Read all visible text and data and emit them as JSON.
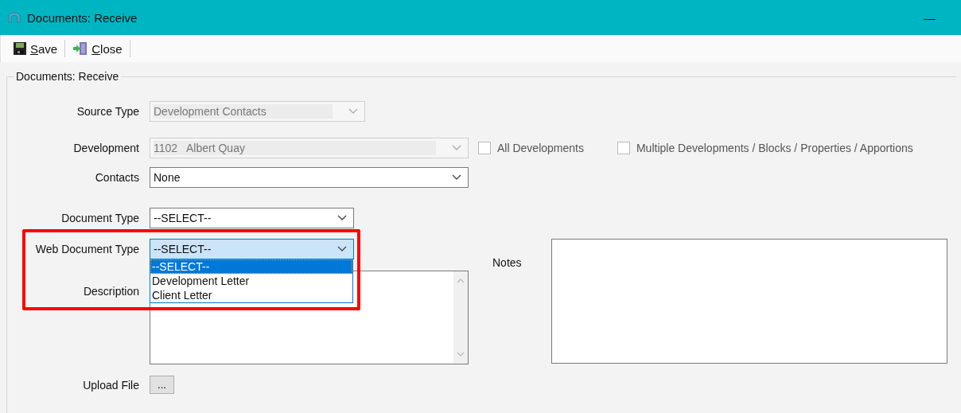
{
  "window": {
    "title": "Documents:  Receive",
    "minimize": "—"
  },
  "toolbar": [
    {
      "label": "Save",
      "kind": "save"
    },
    {
      "label": "Close",
      "kind": "close"
    }
  ],
  "group": {
    "title": "Documents:  Receive"
  },
  "source_type": {
    "label": "Source Type",
    "value": "Development Contacts",
    "disabled": true
  },
  "development": {
    "label": "Development",
    "value": "1102   Albert Quay",
    "disabled": true
  },
  "checkboxes": [
    {
      "label": "All Developments",
      "checked": false
    },
    {
      "label": "Multiple Developments / Blocks / Properties / Apportions",
      "checked": false
    }
  ],
  "contacts": {
    "label": "Contacts",
    "value": "None",
    "disabled": false
  },
  "document_type": {
    "label": "Document Type",
    "value": "--SELECT--",
    "disabled": false
  },
  "web_document_type": {
    "label": "Web Document Type",
    "value": "--SELECT--",
    "expanded": true,
    "highlighted": true,
    "options": [
      {
        "label": "--SELECT--",
        "selected": true
      },
      {
        "label": "Development Letter",
        "selected": false
      },
      {
        "label": "Client Letter",
        "selected": false
      }
    ]
  },
  "description": {
    "label": "Description"
  },
  "notes": {
    "label": "Notes"
  },
  "upload_file": {
    "label": "Upload File",
    "button": "..."
  }
}
